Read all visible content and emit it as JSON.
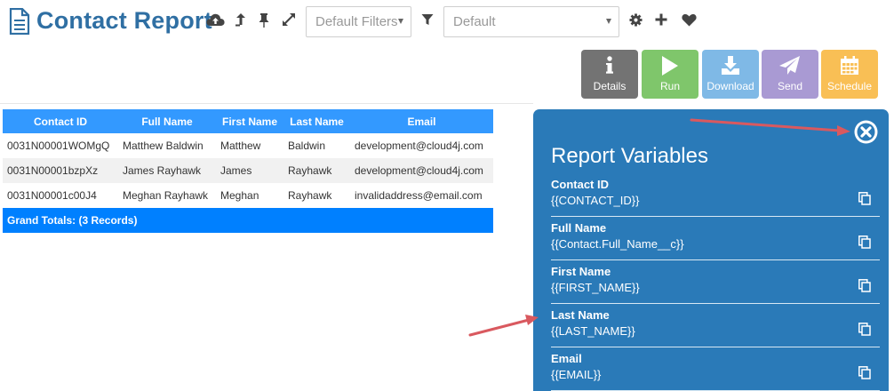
{
  "header": {
    "title": "Contact Report",
    "filter_select": {
      "value": "Default Filters"
    },
    "view_select": {
      "value": "Default"
    }
  },
  "icons": {
    "title": "document-icon",
    "cloud": "cloud-upload-icon",
    "export": "export-icon",
    "pin": "pin-icon",
    "expand": "expand-icon",
    "filter": "filter-icon",
    "settings": "gear-icon",
    "add": "plus-icon",
    "favorite": "heart-icon"
  },
  "actions": [
    {
      "label": "Details",
      "icon": "info-icon",
      "color": "#737373"
    },
    {
      "label": "Run",
      "icon": "play-icon",
      "color": "#7fc66b"
    },
    {
      "label": "Download",
      "icon": "download-icon",
      "color": "#7fb9e6"
    },
    {
      "label": "Send",
      "icon": "paper-plane-icon",
      "color": "#a99ad3"
    },
    {
      "label": "Schedule",
      "icon": "calendar-icon",
      "color": "#f9bf55"
    }
  ],
  "table": {
    "columns": [
      "Contact ID",
      "Full Name",
      "First Name",
      "Last Name",
      "Email"
    ],
    "rows": [
      [
        "0031N00001WOMgQ",
        "Matthew Baldwin",
        "Matthew",
        "Baldwin",
        "development@cloud4j.com"
      ],
      [
        "0031N00001bzpXz",
        "James Rayhawk",
        "James",
        "Rayhawk",
        "development@cloud4j.com"
      ],
      [
        "0031N00001c00J4",
        "Meghan Rayhawk",
        "Meghan",
        "Rayhawk",
        "invalidaddress@email.com"
      ]
    ],
    "grand_total": "Grand Totals: (3 Records)"
  },
  "variables_panel": {
    "title": "Report Variables",
    "close_icon": "close-circle-icon",
    "copy_icon": "copy-icon",
    "items": [
      {
        "name": "Contact ID",
        "value": "{{CONTACT_ID}}"
      },
      {
        "name": "Full Name",
        "value": "{{Contact.Full_Name__c}}"
      },
      {
        "name": "First Name",
        "value": "{{FIRST_NAME}}"
      },
      {
        "name": "Last Name",
        "value": "{{LAST_NAME}}"
      },
      {
        "name": "Email",
        "value": "{{EMAIL}}"
      }
    ]
  },
  "colors": {
    "title": "#2f6fa3",
    "table_header": "#3399ff",
    "table_total": "#0080ff",
    "panel": "#2a7ab8",
    "arrow": "#d9595f"
  }
}
